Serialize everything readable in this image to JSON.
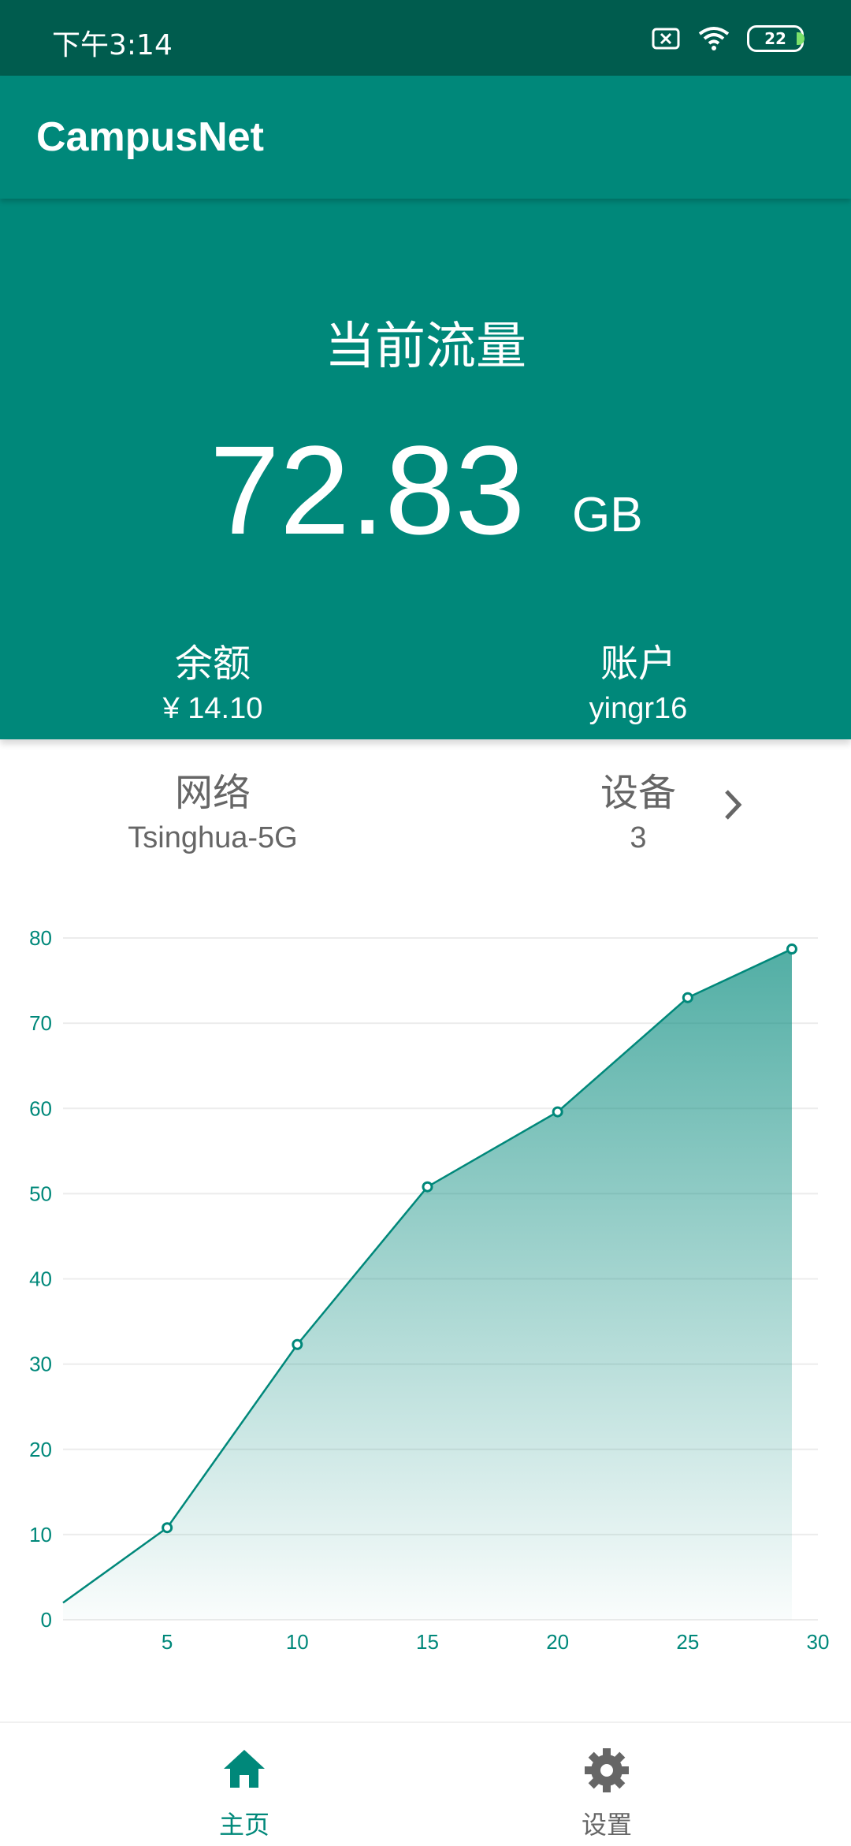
{
  "status_bar": {
    "time": "下午3:14",
    "battery": "22"
  },
  "app_bar": {
    "title": "CampusNet"
  },
  "usage": {
    "label": "当前流量",
    "value": "72.83",
    "unit": "GB"
  },
  "stats": {
    "balance": {
      "label": "余额",
      "value": "¥ 14.10"
    },
    "account": {
      "label": "账户",
      "value": "yingr16"
    },
    "network": {
      "label": "网络",
      "value": "Tsinghua-5G"
    },
    "devices": {
      "label": "设备",
      "value": "3"
    }
  },
  "nav": {
    "home_label": "主页",
    "settings_label": "设置"
  },
  "colors": {
    "primary": "#00887a",
    "status_bar": "#005c4e",
    "secondary_text": "#666666"
  },
  "chart_data": {
    "type": "area",
    "x": [
      1,
      5,
      10,
      15,
      20,
      25,
      29
    ],
    "y": [
      2,
      10.8,
      32.3,
      50.8,
      59.6,
      73.0,
      78.7
    ],
    "xticks": [
      5,
      10,
      15,
      20,
      25,
      30
    ],
    "yticks": [
      0,
      10,
      20,
      30,
      40,
      50,
      60,
      70,
      80
    ],
    "xlim": [
      1,
      30
    ],
    "ylim": [
      0,
      80
    ],
    "grid": true,
    "title": "",
    "xlabel": "",
    "ylabel": ""
  }
}
